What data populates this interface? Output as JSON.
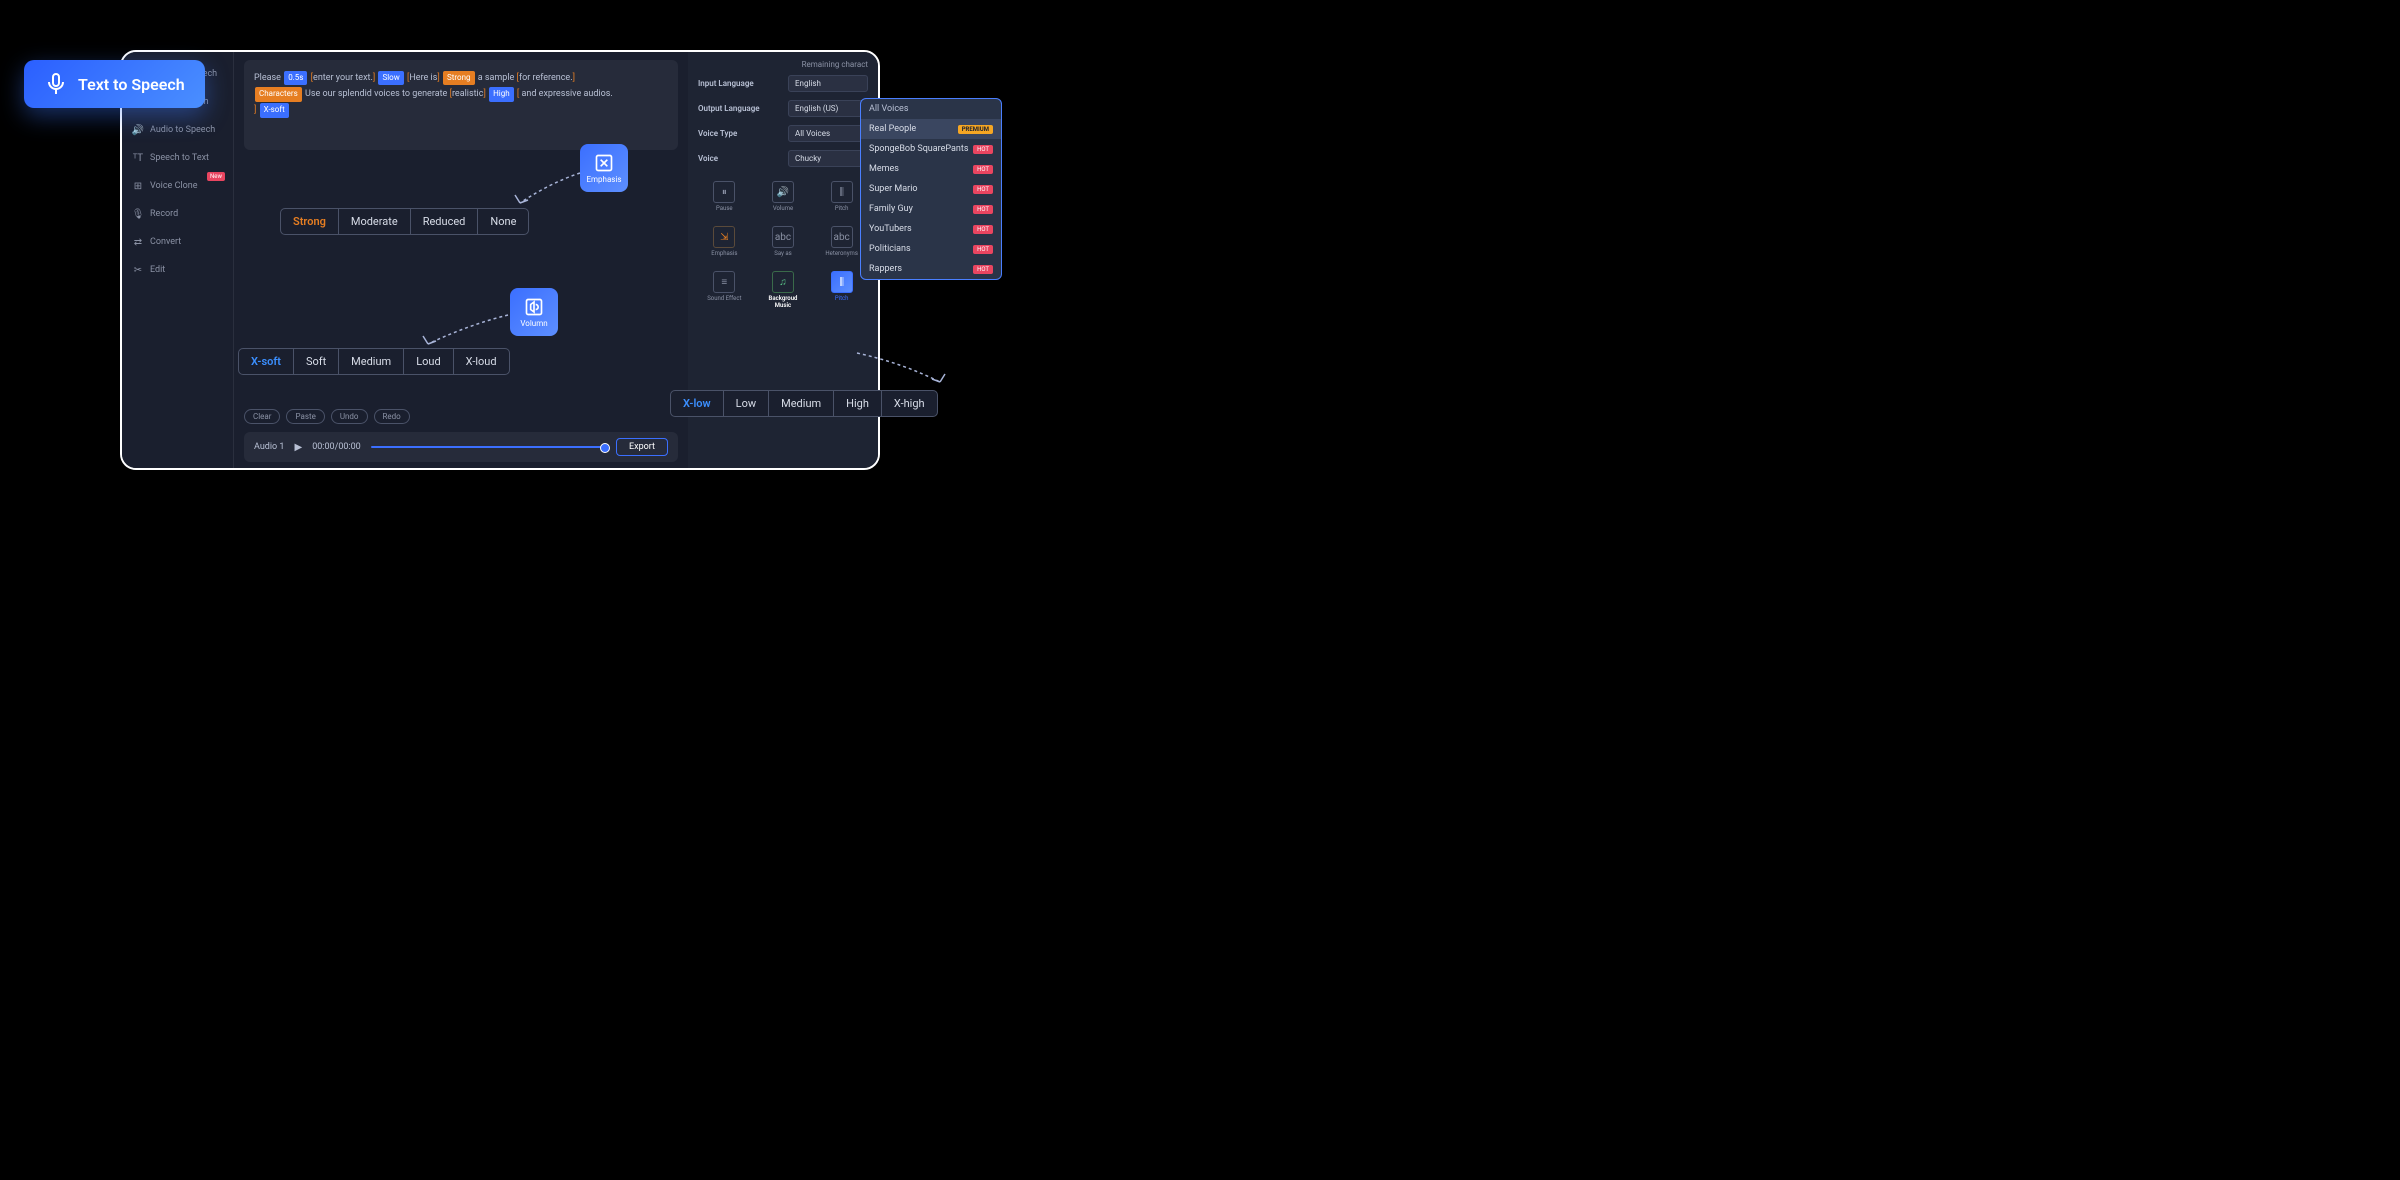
{
  "floating_badge": {
    "label": "Text  to Speech"
  },
  "sidebar": {
    "items": [
      {
        "label": "Image to Speech"
      },
      {
        "label": "PDF to Speech"
      },
      {
        "label": "Audio to Speech"
      },
      {
        "label": "Speech to Text"
      },
      {
        "label": "Voice Clone",
        "badge": "New"
      },
      {
        "label": "Record"
      },
      {
        "label": "Convert"
      },
      {
        "label": "Edit"
      }
    ]
  },
  "editor": {
    "text_parts": {
      "p1": "Please ",
      "tag_05s": "0.5s",
      "p2": "enter your text.",
      "tag_slow": "Slow",
      "p3": "Here is",
      "tag_strong": "Strong",
      "p4": " a sample ",
      "p5": "for reference.",
      "tag_chars": "Characters",
      "p6": " Use our splendid voices to generate ",
      "p7": "realistic",
      "tag_high": "High",
      "p8": " and expressive audios. ",
      "tag_xsoft": "X-soft"
    },
    "toolbar": {
      "clear": "Clear",
      "paste": "Paste",
      "undo": "Undo",
      "redo": "Redo"
    }
  },
  "player": {
    "name": "Audio 1",
    "time": "00:00/00:00",
    "export": "Export"
  },
  "right_panel": {
    "remaining": "Remaining charact",
    "fields": {
      "input_lang_label": "Input Language",
      "input_lang_value": "English",
      "output_lang_label": "Output Language",
      "output_lang_value": "English (US)",
      "voice_type_label": "Voice Type",
      "voice_type_value": "All Voices",
      "voice_label": "Voice",
      "voice_value": "Chucky"
    },
    "tools": {
      "pause": "Pause",
      "volume": "Volume",
      "pitch": "Pitch",
      "emphasis": "Emphasis",
      "say_as": "Say as",
      "heteronyms": "Heteronyms",
      "sound_effect": "Sound Effect",
      "bg_music": "Backgroud Music",
      "pitch2": "Pitch"
    }
  },
  "voice_dropdown": {
    "header": "All Voices",
    "items": [
      {
        "label": "Real People",
        "badge": "PREMIUM",
        "badge_type": "premium"
      },
      {
        "label": "SpongeBob SquarePants",
        "badge": "HOT",
        "badge_type": "hot"
      },
      {
        "label": "Memes",
        "badge": "HOT",
        "badge_type": "hot"
      },
      {
        "label": "Super Mario",
        "badge": "HOT",
        "badge_type": "hot"
      },
      {
        "label": "Family Guy",
        "badge": "HOT",
        "badge_type": "hot"
      },
      {
        "label": "YouTubers",
        "badge": "HOT",
        "badge_type": "hot"
      },
      {
        "label": "Politicians",
        "badge": "HOT",
        "badge_type": "hot"
      },
      {
        "label": "Rappers",
        "badge": "HOT",
        "badge_type": "hot"
      }
    ]
  },
  "popups": {
    "emphasis": "Emphasis",
    "volume": "Volumn"
  },
  "option_bars": {
    "emphasis": [
      "Strong",
      "Moderate",
      "Reduced",
      "None"
    ],
    "volume": [
      "X-soft",
      "Soft",
      "Medium",
      "Loud",
      "X-loud"
    ],
    "pitch": [
      "X-low",
      "Low",
      "Medium",
      "High",
      "X-high"
    ]
  }
}
